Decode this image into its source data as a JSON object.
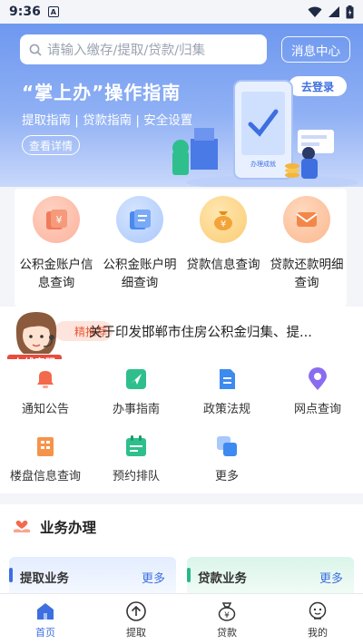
{
  "status_bar": {
    "time": "9:36",
    "app_badge": "A"
  },
  "search": {
    "placeholder": "请输入缴存/提取/贷款/归集"
  },
  "header": {
    "message_center": "消息中心"
  },
  "banner": {
    "title": "“掌上办”操作指南",
    "links": "提取指南 | 贷款指南 | 安全设置",
    "detail_button": "查看详情",
    "login_button": "去登录",
    "illustration_caption": "办理成就"
  },
  "quick_services": [
    {
      "label": "公积金账户信息查询",
      "icon": "yuan-card-icon",
      "color": "#f0785a"
    },
    {
      "label": "公积金账户明细查询",
      "icon": "document-card-icon",
      "color": "#4a8af0"
    },
    {
      "label": "贷款信息查询",
      "icon": "money-bag-icon",
      "color": "#f4a338"
    },
    {
      "label": "贷款还款明细查询",
      "icon": "message-icon",
      "color": "#f3874a"
    }
  ],
  "news": {
    "badge": "精推荐",
    "text": "关于印发邯郸市住房公积金归集、提..."
  },
  "online_service": "在线客服",
  "grid_items": [
    {
      "label": "通知公告",
      "icon": "bell-icon"
    },
    {
      "label": "办事指南",
      "icon": "guide-arrow-icon"
    },
    {
      "label": "政策法规",
      "icon": "document-icon"
    },
    {
      "label": "网点查询",
      "icon": "location-pin-icon"
    },
    {
      "label": "楼盘信息查询",
      "icon": "building-icon"
    },
    {
      "label": "预约排队",
      "icon": "calendar-icon"
    },
    {
      "label": "更多",
      "icon": "more-squares-icon"
    }
  ],
  "business": {
    "title": "业务办理",
    "cards": [
      {
        "title": "提取业务",
        "more": "更多"
      },
      {
        "title": "贷款业务",
        "more": "更多"
      }
    ]
  },
  "tabs": [
    {
      "label": "首页",
      "active": true
    },
    {
      "label": "提取",
      "active": false
    },
    {
      "label": "贷款",
      "active": false
    },
    {
      "label": "我的",
      "active": false
    }
  ],
  "colors": {
    "primary": "#3d6fe0",
    "banner_top": "#6e98ef",
    "accent_red": "#e84c3d",
    "accent_green": "#26b889"
  }
}
